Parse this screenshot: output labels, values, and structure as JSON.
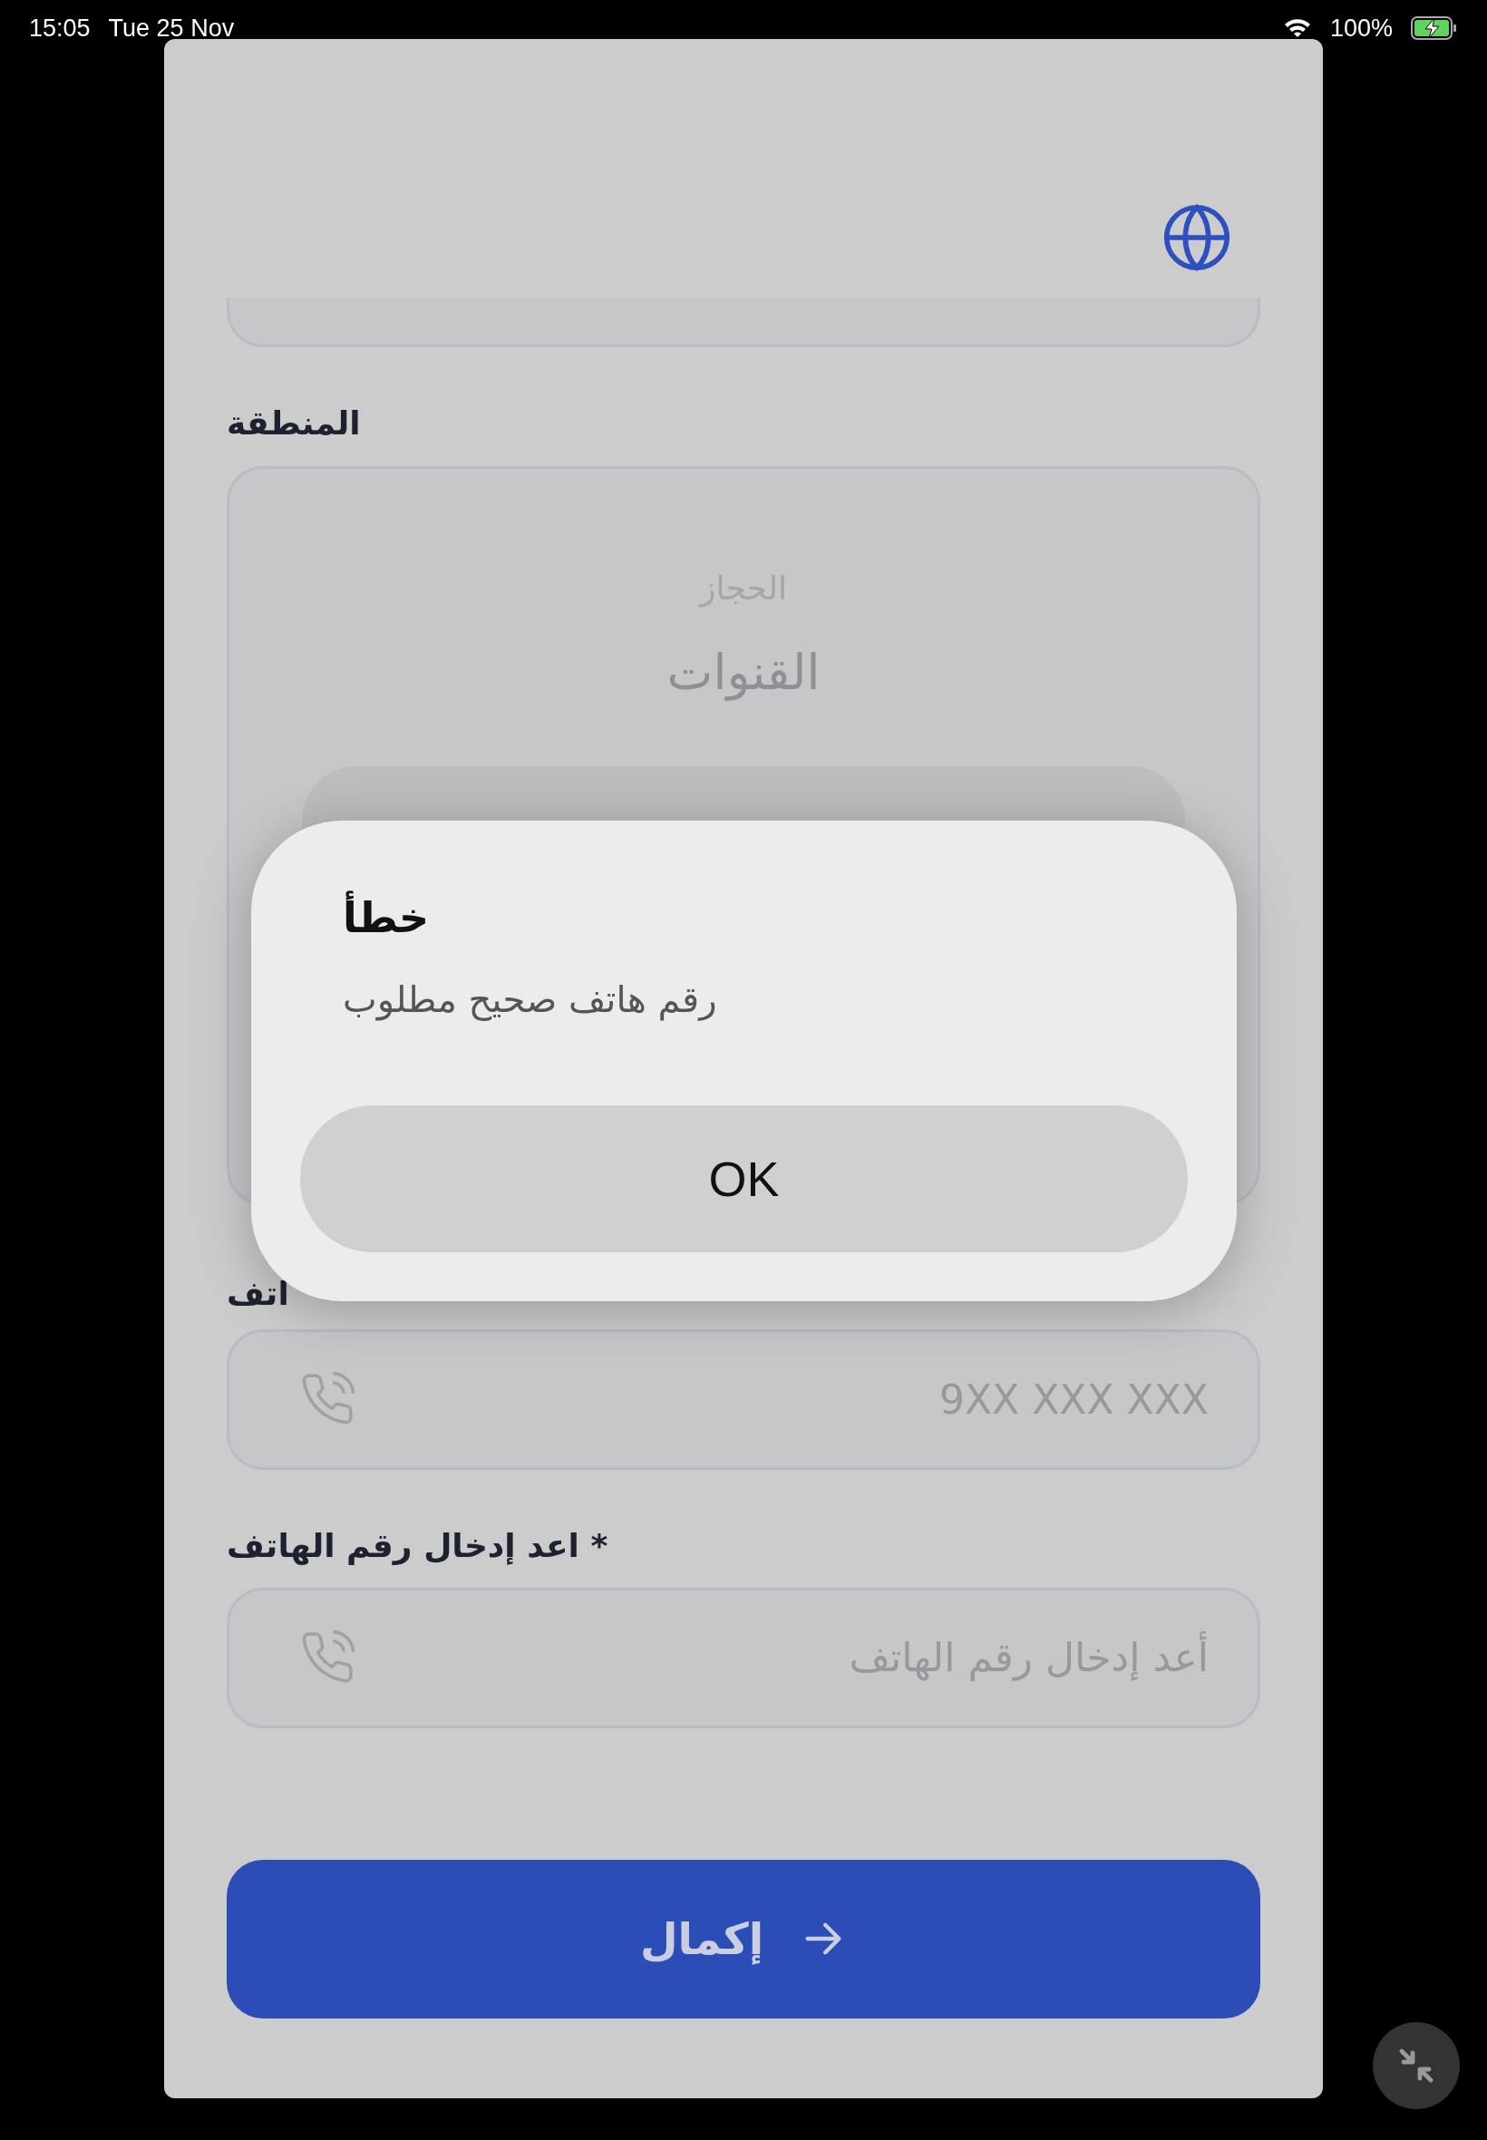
{
  "status_bar": {
    "time": "15:05",
    "date": "Tue 25 Nov",
    "battery": "100%"
  },
  "region": {
    "label": "المنطقة",
    "options": [
      {
        "label": "الحجاز",
        "kind": "far"
      },
      {
        "label": "القنوات",
        "kind": "near"
      }
    ]
  },
  "phone": {
    "label": "اتف",
    "placeholder": "9XX XXX XXX"
  },
  "phone_confirm": {
    "label": "اعد إدخال رقم الهاتف *",
    "placeholder": "أعد إدخال رقم الهاتف"
  },
  "submit": {
    "label": "إكمال"
  },
  "alert": {
    "title": "خطأ",
    "message": "رقم هاتف صحيح مطلوب",
    "button": "OK"
  }
}
